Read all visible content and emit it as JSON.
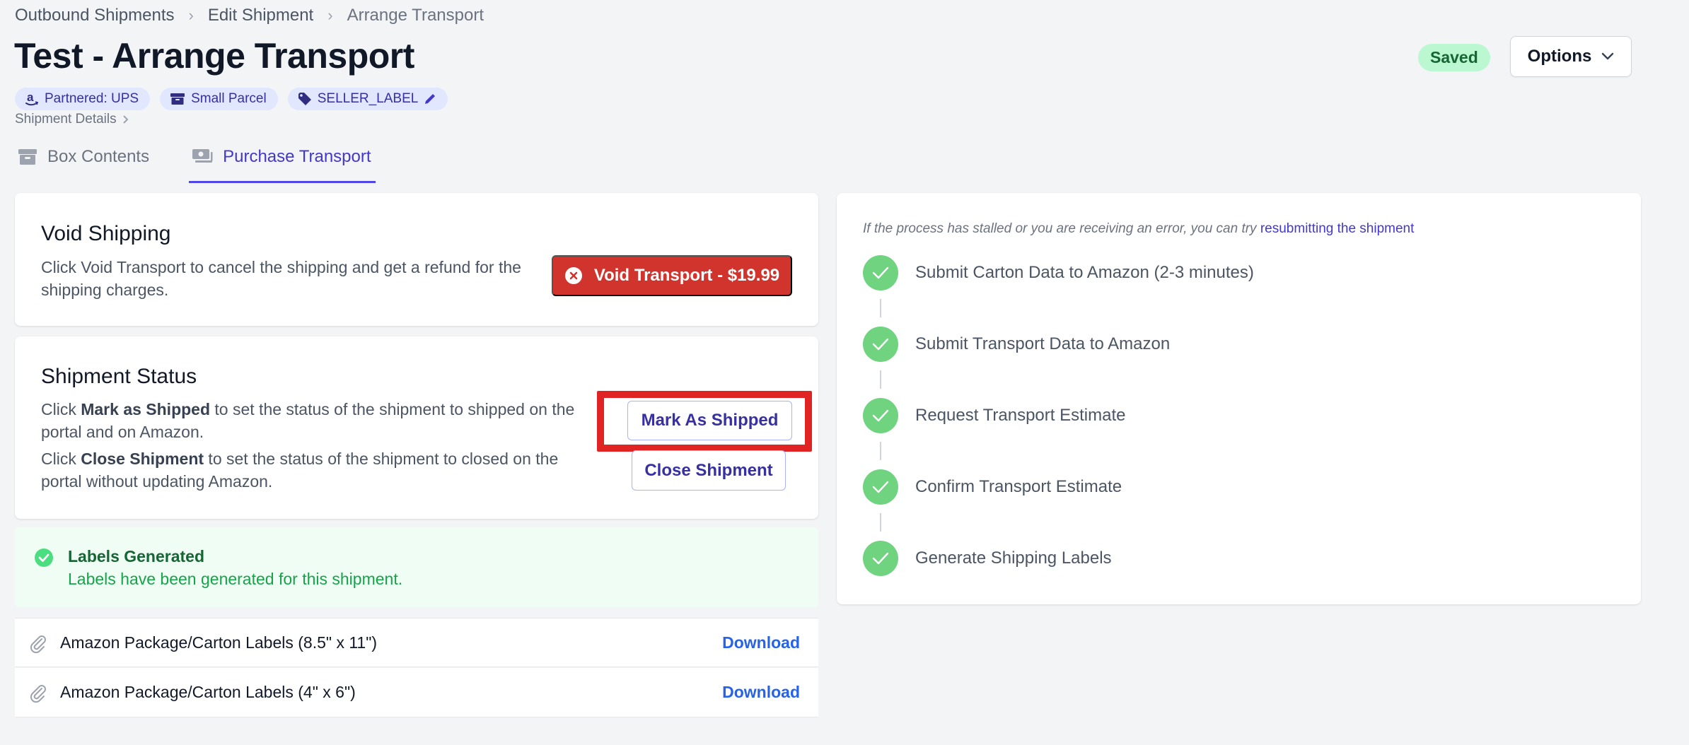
{
  "breadcrumb": {
    "items": [
      "Outbound Shipments",
      "Edit Shipment",
      "Arrange Transport"
    ]
  },
  "page": {
    "title": "Test - Arrange Transport",
    "saved_badge": "Saved",
    "options_label": "Options"
  },
  "tags": [
    {
      "label": "Partnered: UPS",
      "icon": "amazon-icon"
    },
    {
      "label": "Small Parcel",
      "icon": "archive-box-icon"
    },
    {
      "label": "SELLER_LABEL",
      "icon": "tag-icon"
    }
  ],
  "details_link": "Shipment Details",
  "tabs": [
    {
      "label": "Box Contents",
      "icon": "archive-box-icon",
      "active": false
    },
    {
      "label": "Purchase Transport",
      "icon": "truck-money-icon",
      "active": true
    }
  ],
  "void": {
    "title": "Void Shipping",
    "text": "Click Void Transport to cancel the shipping and get a refund for the shipping charges.",
    "button": "Void Transport - $19.99"
  },
  "status": {
    "title": "Shipment Status",
    "line1_prefix": "Click ",
    "line1_bold": "Mark as Shipped",
    "line1_suffix": " to set the status of the shipment to shipped on the portal and on Amazon.",
    "line2_prefix": "Click ",
    "line2_bold": "Close Shipment",
    "line2_suffix": " to set the status of the shipment to closed on the portal without updating Amazon.",
    "mark_button": "Mark As Shipped",
    "close_button": "Close Shipment"
  },
  "labels": {
    "title": "Labels Generated",
    "text": "Labels have been generated for this shipment.",
    "files": [
      {
        "name": "Amazon Package/Carton Labels (8.5\" x 11\")",
        "action": "Download"
      },
      {
        "name": "Amazon Package/Carton Labels (4\" x 6\")",
        "action": "Download"
      }
    ]
  },
  "process": {
    "note_prefix": "If the process has stalled or you are receiving an error, you can try ",
    "note_link": "resubmitting the shipment",
    "steps": [
      "Submit Carton Data to Amazon (2-3 minutes)",
      "Submit Transport Data to Amazon",
      "Request Transport Estimate",
      "Confirm Transport Estimate",
      "Generate Shipping Labels"
    ]
  },
  "colors": {
    "accent": "#4f46e5",
    "danger": "#d0342c",
    "success": "#6fd37f",
    "link": "#2563eb"
  }
}
